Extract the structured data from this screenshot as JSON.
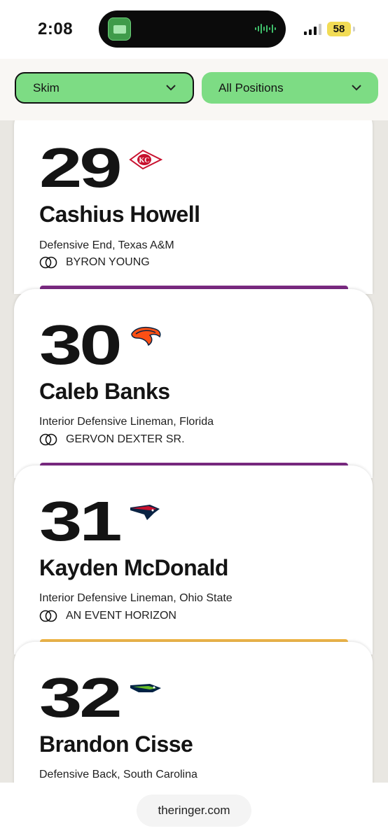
{
  "status_bar": {
    "time": "2:08",
    "battery": "58"
  },
  "filters": {
    "skim_label": "Skim",
    "position_label": "All Positions"
  },
  "picks": [
    {
      "number": "29",
      "team_icon": "chiefs-logo",
      "name": "Cashius Howell",
      "position": "Defensive End, Texas A&M",
      "comparison": "BYRON YOUNG"
    },
    {
      "number": "30",
      "team_icon": "broncos-logo",
      "name": "Caleb Banks",
      "position": "Interior Defensive Lineman, Florida",
      "comparison": "GERVON DEXTER SR."
    },
    {
      "number": "31",
      "team_icon": "patriots-logo",
      "name": "Kayden McDonald",
      "position": "Interior Defensive Lineman, Ohio State",
      "comparison": "AN EVENT HORIZON"
    },
    {
      "number": "32",
      "team_icon": "seahawks-logo",
      "name": "Brandon Cisse",
      "position": "Defensive Back, South Carolina",
      "comparison": ""
    }
  ],
  "colors": {
    "filter_green": "#7ddc84",
    "strip_purple": "#7b2a83",
    "strip_gold": "#f1b84a"
  },
  "browser": {
    "url": "theringer.com"
  }
}
